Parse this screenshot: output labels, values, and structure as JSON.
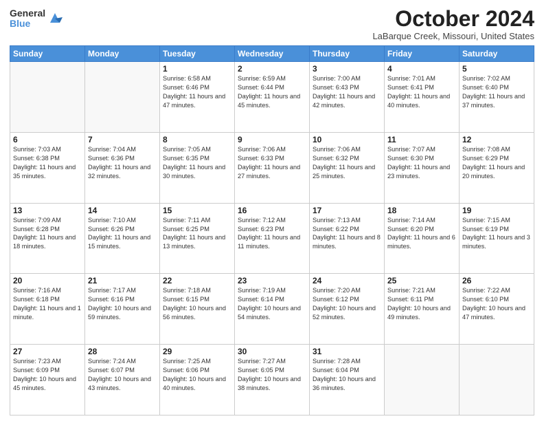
{
  "header": {
    "logo_general": "General",
    "logo_blue": "Blue",
    "title": "October 2024",
    "subtitle": "LaBarque Creek, Missouri, United States"
  },
  "days_of_week": [
    "Sunday",
    "Monday",
    "Tuesday",
    "Wednesday",
    "Thursday",
    "Friday",
    "Saturday"
  ],
  "weeks": [
    [
      {
        "day": "",
        "info": ""
      },
      {
        "day": "",
        "info": ""
      },
      {
        "day": "1",
        "info": "Sunrise: 6:58 AM\nSunset: 6:46 PM\nDaylight: 11 hours and 47 minutes."
      },
      {
        "day": "2",
        "info": "Sunrise: 6:59 AM\nSunset: 6:44 PM\nDaylight: 11 hours and 45 minutes."
      },
      {
        "day": "3",
        "info": "Sunrise: 7:00 AM\nSunset: 6:43 PM\nDaylight: 11 hours and 42 minutes."
      },
      {
        "day": "4",
        "info": "Sunrise: 7:01 AM\nSunset: 6:41 PM\nDaylight: 11 hours and 40 minutes."
      },
      {
        "day": "5",
        "info": "Sunrise: 7:02 AM\nSunset: 6:40 PM\nDaylight: 11 hours and 37 minutes."
      }
    ],
    [
      {
        "day": "6",
        "info": "Sunrise: 7:03 AM\nSunset: 6:38 PM\nDaylight: 11 hours and 35 minutes."
      },
      {
        "day": "7",
        "info": "Sunrise: 7:04 AM\nSunset: 6:36 PM\nDaylight: 11 hours and 32 minutes."
      },
      {
        "day": "8",
        "info": "Sunrise: 7:05 AM\nSunset: 6:35 PM\nDaylight: 11 hours and 30 minutes."
      },
      {
        "day": "9",
        "info": "Sunrise: 7:06 AM\nSunset: 6:33 PM\nDaylight: 11 hours and 27 minutes."
      },
      {
        "day": "10",
        "info": "Sunrise: 7:06 AM\nSunset: 6:32 PM\nDaylight: 11 hours and 25 minutes."
      },
      {
        "day": "11",
        "info": "Sunrise: 7:07 AM\nSunset: 6:30 PM\nDaylight: 11 hours and 23 minutes."
      },
      {
        "day": "12",
        "info": "Sunrise: 7:08 AM\nSunset: 6:29 PM\nDaylight: 11 hours and 20 minutes."
      }
    ],
    [
      {
        "day": "13",
        "info": "Sunrise: 7:09 AM\nSunset: 6:28 PM\nDaylight: 11 hours and 18 minutes."
      },
      {
        "day": "14",
        "info": "Sunrise: 7:10 AM\nSunset: 6:26 PM\nDaylight: 11 hours and 15 minutes."
      },
      {
        "day": "15",
        "info": "Sunrise: 7:11 AM\nSunset: 6:25 PM\nDaylight: 11 hours and 13 minutes."
      },
      {
        "day": "16",
        "info": "Sunrise: 7:12 AM\nSunset: 6:23 PM\nDaylight: 11 hours and 11 minutes."
      },
      {
        "day": "17",
        "info": "Sunrise: 7:13 AM\nSunset: 6:22 PM\nDaylight: 11 hours and 8 minutes."
      },
      {
        "day": "18",
        "info": "Sunrise: 7:14 AM\nSunset: 6:20 PM\nDaylight: 11 hours and 6 minutes."
      },
      {
        "day": "19",
        "info": "Sunrise: 7:15 AM\nSunset: 6:19 PM\nDaylight: 11 hours and 3 minutes."
      }
    ],
    [
      {
        "day": "20",
        "info": "Sunrise: 7:16 AM\nSunset: 6:18 PM\nDaylight: 11 hours and 1 minute."
      },
      {
        "day": "21",
        "info": "Sunrise: 7:17 AM\nSunset: 6:16 PM\nDaylight: 10 hours and 59 minutes."
      },
      {
        "day": "22",
        "info": "Sunrise: 7:18 AM\nSunset: 6:15 PM\nDaylight: 10 hours and 56 minutes."
      },
      {
        "day": "23",
        "info": "Sunrise: 7:19 AM\nSunset: 6:14 PM\nDaylight: 10 hours and 54 minutes."
      },
      {
        "day": "24",
        "info": "Sunrise: 7:20 AM\nSunset: 6:12 PM\nDaylight: 10 hours and 52 minutes."
      },
      {
        "day": "25",
        "info": "Sunrise: 7:21 AM\nSunset: 6:11 PM\nDaylight: 10 hours and 49 minutes."
      },
      {
        "day": "26",
        "info": "Sunrise: 7:22 AM\nSunset: 6:10 PM\nDaylight: 10 hours and 47 minutes."
      }
    ],
    [
      {
        "day": "27",
        "info": "Sunrise: 7:23 AM\nSunset: 6:09 PM\nDaylight: 10 hours and 45 minutes."
      },
      {
        "day": "28",
        "info": "Sunrise: 7:24 AM\nSunset: 6:07 PM\nDaylight: 10 hours and 43 minutes."
      },
      {
        "day": "29",
        "info": "Sunrise: 7:25 AM\nSunset: 6:06 PM\nDaylight: 10 hours and 40 minutes."
      },
      {
        "day": "30",
        "info": "Sunrise: 7:27 AM\nSunset: 6:05 PM\nDaylight: 10 hours and 38 minutes."
      },
      {
        "day": "31",
        "info": "Sunrise: 7:28 AM\nSunset: 6:04 PM\nDaylight: 10 hours and 36 minutes."
      },
      {
        "day": "",
        "info": ""
      },
      {
        "day": "",
        "info": ""
      }
    ]
  ]
}
